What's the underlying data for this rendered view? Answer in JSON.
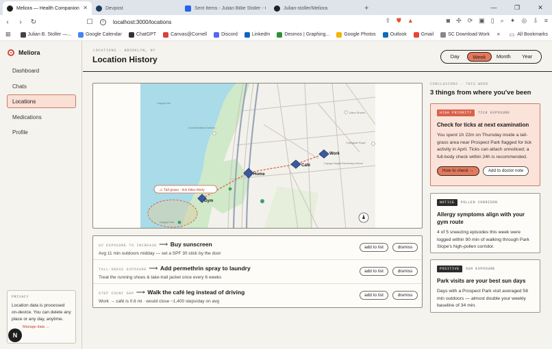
{
  "browser": {
    "tabs": [
      {
        "title": "Meliora — Health Companion",
        "active": true,
        "color": "#1e1e1e"
      },
      {
        "title": "Devpost",
        "active": false,
        "color": "#1b3a5c"
      },
      {
        "title": "Sent Items - Julian Billie Stoller - Outl",
        "active": false,
        "color": "#2563eb"
      },
      {
        "title": "Julian-stoller/Meliora",
        "active": false,
        "color": "#222222"
      }
    ],
    "new_tab": "+",
    "url": "localhost:3000/locations",
    "bookmarks": [
      {
        "label": "Julian B. Stoller —...",
        "color": "#444444"
      },
      {
        "label": "Google Calendar",
        "color": "#4285f4"
      },
      {
        "label": "ChatGPT",
        "color": "#333333"
      },
      {
        "label": "Canvas@Cornell",
        "color": "#d9413a"
      },
      {
        "label": "Discord",
        "color": "#5865f2"
      },
      {
        "label": "LinkedIn",
        "color": "#0a66c2"
      },
      {
        "label": "Desmos | Graphing...",
        "color": "#2f8f3a"
      },
      {
        "label": "Google Photos",
        "color": "#f4b400"
      },
      {
        "label": "Outlook",
        "color": "#0f6cbd"
      },
      {
        "label": "Gmail",
        "color": "#ea4335"
      },
      {
        "label": "SC Download Work",
        "color": "#888888"
      }
    ],
    "bookmarks_more": "»",
    "all_bookmarks": "All Bookmarks"
  },
  "sidebar": {
    "brand": "Meliora",
    "items": [
      {
        "label": "Dashboard",
        "active": false
      },
      {
        "label": "Chats",
        "active": false
      },
      {
        "label": "Locations",
        "active": true
      },
      {
        "label": "Medications",
        "active": false
      },
      {
        "label": "Profile",
        "active": false
      }
    ],
    "privacy": {
      "label": "PRIVACY",
      "text": "Location data is processed on-device. You can delete any place or any day, anytime.",
      "link": "Manage data →"
    },
    "avatar": "N"
  },
  "header": {
    "breadcrumb": "LOCATIONS · BROOKLYN, NY",
    "title": "Location History",
    "ranges": [
      "Day",
      "Week",
      "Month",
      "Year"
    ],
    "active_range": "Week"
  },
  "map": {
    "places": [
      "Home",
      "Café",
      "Work",
      "Gym"
    ],
    "warning": "⚠ Tall grass · tick bites likely",
    "street_labels": [
      "Dana Shoem",
      "Collegiate Road",
      "Cayuga Heights Elementary School",
      "Cornell Botanic Gardens",
      "Cayuga Inlet",
      "Cayuga Park"
    ]
  },
  "recommendations": [
    {
      "tag": "UV EXPOSURE TO INCREASE",
      "title": "Buy sunscreen",
      "sub": "Avg 11 min outdoors midday — set a SPF 30 stick by the door",
      "add": "add to list",
      "dismiss": "dismiss"
    },
    {
      "tag": "TALL-GRASS EXPOSURE",
      "title": "Add permethrin spray to laundry",
      "sub": "Treat the running shoes & take-trail jacket once every 6 weeks",
      "add": "add to list",
      "dismiss": "dismiss"
    },
    {
      "tag": "STEP COUNT GAP",
      "title": "Walk the café leg instead of driving",
      "sub": "Work → café is 0.6 mi · would close ~1,400 steps/day on avg",
      "add": "add to list",
      "dismiss": "dismiss"
    }
  ],
  "conclusions": {
    "label": "CONCLUSIONS · THIS WEEK",
    "title": "3 things from where you've been",
    "cards": [
      {
        "badge": "HIGH PRIORITY",
        "category": "TICK EXPOSURE",
        "title": "Check for ticks at next examination",
        "body": "You spent 1h 22m on Thursday inside a tall-grass area near Prospect Park flagged for tick activity in April. Ticks can attach unnoticed; a full-body check within 24h is recommended.",
        "primary": "How to check →",
        "secondary": "Add to doctor note"
      },
      {
        "badge": "NOTICE",
        "category": "POLLEN CORRIDOR",
        "title": "Allergy symptoms align with your gym route",
        "body": "4 of 5 sneezing episodes this week were logged within 90 min of walking through Park Slope's high-pollen corridor."
      },
      {
        "badge": "POSITIVE",
        "category": "SUN EXPOSURE",
        "title": "Park visits are your best sun days",
        "body": "Days with a Prospect Park visit averaged 58 min outdoors — almost double your weekly baseline of 34 min."
      }
    ]
  }
}
